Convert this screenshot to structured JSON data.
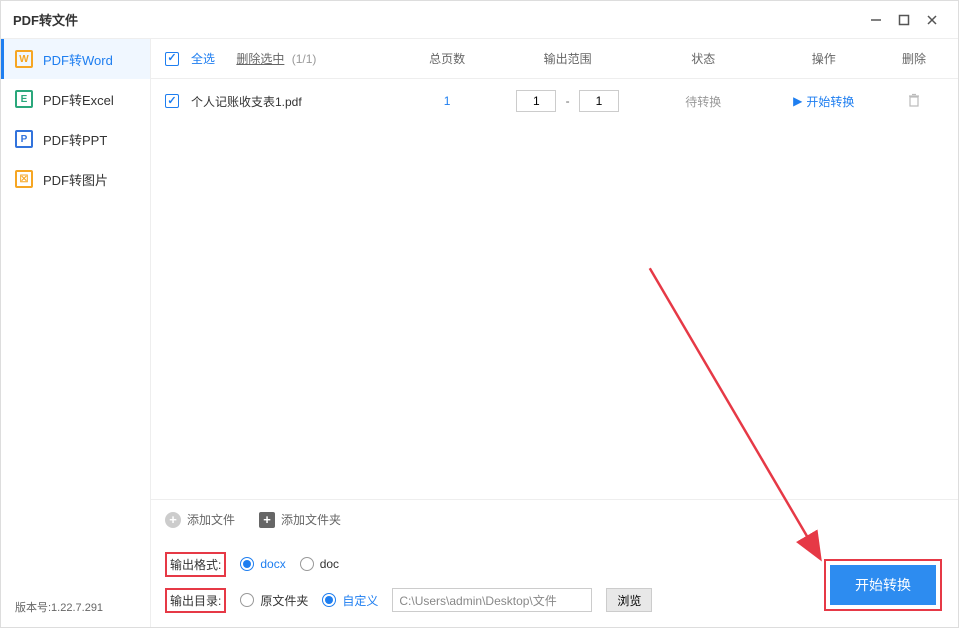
{
  "titlebar": {
    "title": "PDF转文件"
  },
  "sidebar": {
    "items": [
      {
        "label": "PDF转Word",
        "iconLetter": "W"
      },
      {
        "label": "PDF转Excel",
        "iconLetter": "E"
      },
      {
        "label": "PDF转PPT",
        "iconLetter": "P"
      },
      {
        "label": "PDF转图片",
        "iconLetter": "☒"
      }
    ],
    "version": "版本号:1.22.7.291"
  },
  "table": {
    "selectAll": "全选",
    "deleteSelected": "删除选中",
    "count": "(1/1)",
    "headers": {
      "pages": "总页数",
      "range": "输出范围",
      "status": "状态",
      "op": "操作",
      "del": "删除"
    }
  },
  "file": {
    "name": "个人记账收支表1.pdf",
    "pages": "1",
    "rangeFrom": "1",
    "rangeTo": "1",
    "status": "待转换",
    "start": "开始转换"
  },
  "addbar": {
    "addFile": "添加文件",
    "addFolder": "添加文件夹"
  },
  "options": {
    "formatLabel": "输出格式:",
    "docx": "docx",
    "doc": "doc",
    "dirLabel": "输出目录:",
    "original": "原文件夹",
    "custom": "自定义",
    "path": "C:\\Users\\admin\\Desktop\\文件",
    "browse": "浏览"
  },
  "action": {
    "start": "开始转换"
  }
}
